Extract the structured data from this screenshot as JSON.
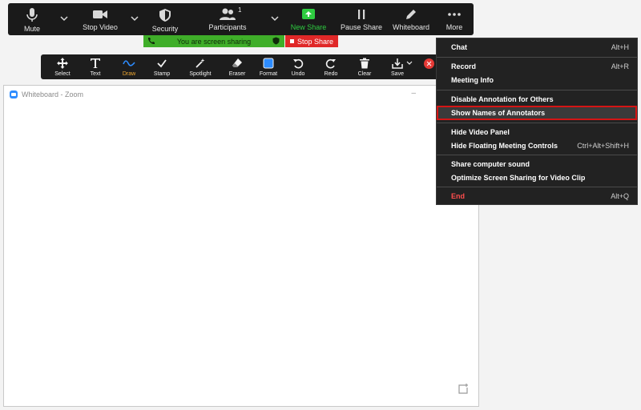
{
  "meeting_toolbar": {
    "mute": "Mute",
    "stop_video": "Stop Video",
    "security": "Security",
    "participants": "Participants",
    "participants_count": "1",
    "new_share": "New Share",
    "pause_share": "Pause Share",
    "whiteboard": "Whiteboard",
    "more": "More"
  },
  "share_banner": {
    "status": "You are screen sharing",
    "stop_share": "Stop Share"
  },
  "annotation_toolbar": {
    "select": "Select",
    "text": "Text",
    "draw": "Draw",
    "stamp": "Stamp",
    "spotlight": "Spotlight",
    "eraser": "Eraser",
    "format": "Format",
    "undo": "Undo",
    "redo": "Redo",
    "clear": "Clear",
    "save": "Save"
  },
  "whiteboard_window": {
    "title": "Whiteboard - Zoom",
    "min_glyph": "–"
  },
  "more_menu": {
    "items": [
      {
        "label": "Chat",
        "shortcut": "Alt+H"
      },
      {
        "label": "Record",
        "shortcut": "Alt+R"
      },
      {
        "label": "Meeting Info",
        "shortcut": ""
      },
      {
        "label": "Disable Annotation for Others",
        "shortcut": ""
      },
      {
        "label": "Show Names of Annotators",
        "shortcut": "",
        "highlighted": true
      },
      {
        "label": "Hide Video Panel",
        "shortcut": ""
      },
      {
        "label": "Hide Floating Meeting Controls",
        "shortcut": "Ctrl+Alt+Shift+H"
      },
      {
        "label": "Share computer sound",
        "shortcut": ""
      },
      {
        "label": "Optimize Screen Sharing for Video Clip",
        "shortcut": ""
      },
      {
        "label": "End",
        "shortcut": "Alt+Q"
      }
    ]
  },
  "colors": {
    "toolbar_bg": "#1a1a1a",
    "share_green": "#3fae29",
    "stop_red": "#e02828",
    "highlight_border": "#d41515",
    "active_tool": "#f0a830",
    "zoom_blue": "#2d8cff"
  }
}
